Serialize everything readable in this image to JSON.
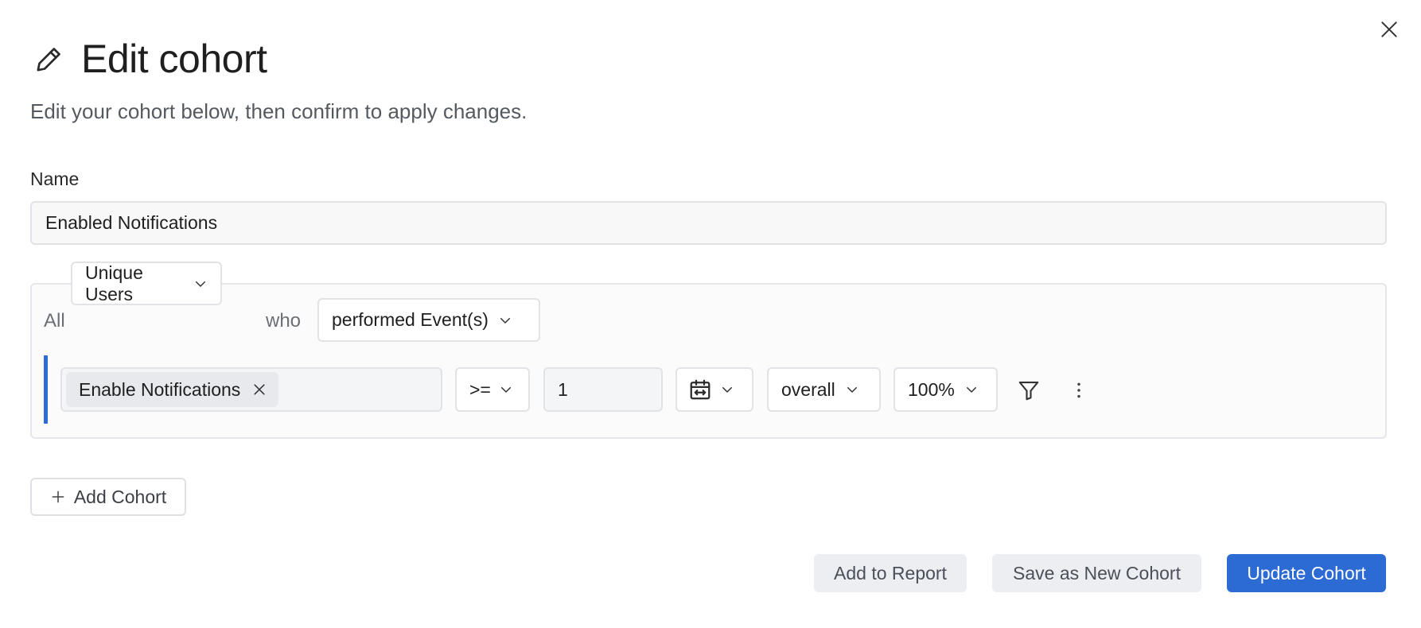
{
  "header": {
    "title": "Edit cohort",
    "subtitle": "Edit your cohort below, then confirm to apply changes."
  },
  "form": {
    "name_label": "Name",
    "name_value": "Enabled Notifications"
  },
  "cohort": {
    "all_label": "All",
    "users_dropdown": "Unique Users",
    "who_label": "who",
    "action_dropdown": "performed Event(s)",
    "event_chip": "Enable Notifications",
    "operator": ">=",
    "count": "1",
    "scope": "overall",
    "percent": "100%"
  },
  "actions": {
    "add_cohort": "Add Cohort",
    "add_to_report": "Add to Report",
    "save_as_new": "Save as New Cohort",
    "update": "Update Cohort"
  },
  "colors": {
    "accent": "#2c6bd3",
    "secondary_button": "#eceef2"
  }
}
